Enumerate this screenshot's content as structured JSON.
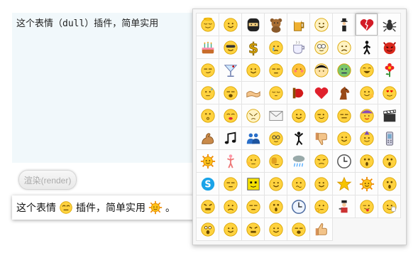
{
  "editor": {
    "text": "这个表情（dull）插件，简单实用"
  },
  "render_button": {
    "label": "渲染(render)"
  },
  "output": {
    "part1": "这个表情",
    "emoji1": "dull-face",
    "part2": "插件，简单实用",
    "emoji2": "sun-face",
    "part3": "。"
  },
  "emoticons": [
    "angel",
    "worried",
    "ninja",
    "teddy-bear",
    "beer-mug",
    "grin-face",
    "person-with-hat",
    "broken-heart",
    "bug",
    "birthday-cake",
    "cool-face",
    "dollar-sign",
    "cry-face",
    "coffee-cup",
    "goggles-face",
    "sad-face",
    "walking-figure",
    "devil",
    "smug-face",
    "cocktail",
    "smile-face",
    "sleepy-face",
    "blush-face",
    "black-hair-face",
    "sick-face",
    "laugh-face",
    "flower",
    "sweat-face",
    "yawn-face",
    "handshake",
    "shy-face",
    "boxing-glove",
    "heart",
    "horse",
    "wave-face",
    "in-love-face",
    "whistle-face",
    "kiss-face",
    "puzzled-face",
    "envelope",
    "smile-face",
    "wink-face",
    "neutral-face",
    "girl-face",
    "clapperboard",
    "muscle-arm",
    "music-note",
    "people",
    "nerd-face",
    "dancing-figure",
    "thumbs-down",
    "smile-face",
    "party-face",
    "mobile-phone",
    "sun-face",
    "stick-figure",
    "pointing-face",
    "facepalm-face",
    "rain-cloud",
    "annoyed-face",
    "clock-face",
    "surprised-face",
    "surprised-face",
    "skype-logo",
    "sleepy-face",
    "square-face",
    "smile-face",
    "confused-face",
    "smile-face",
    "star",
    "sun-face",
    "surprised-face",
    "angry-face",
    "worried-face",
    "sleepy-face",
    "surprised-face",
    "clock",
    "thinking-face",
    "bandit",
    "tongue-face",
    "waving-face",
    "shocked-face",
    "smile-face",
    "angry-face",
    "smile-face",
    "yawn-face",
    "thumbs-up"
  ]
}
